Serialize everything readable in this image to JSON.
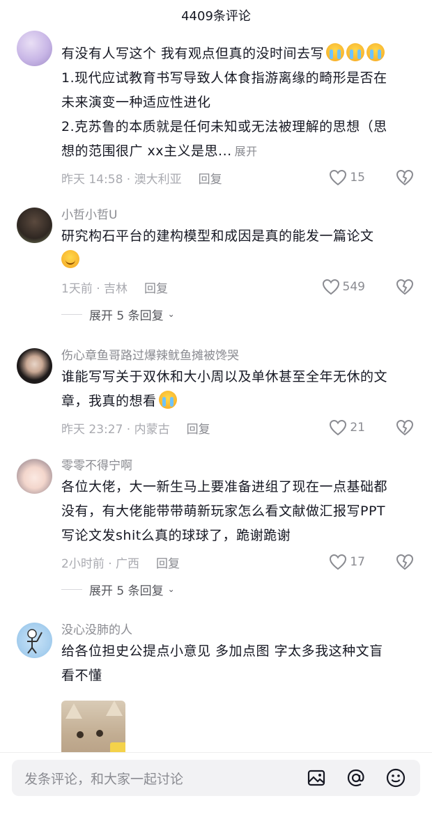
{
  "header": {
    "title": "4409条评论"
  },
  "comments": [
    {
      "username": "",
      "lines": [
        "有没有人写这个 我有观点但真的没时间去写",
        "1.现代应试教育书写导致人体食指游离缘的畸形是否在",
        "未来演变一种适应性进化",
        "2.克苏鲁的本质就是任何未知或无法被理解的思想（思",
        "想的范围很广 xx主义是思..."
      ],
      "expand_inline": "展开",
      "time": "昨天 14:58 · 澳大利亚",
      "reply": "回复",
      "likes": "15"
    },
    {
      "username": "小哲小哲U",
      "lines": [
        "研究构石平台的建构模型和成因是真的能发一篇论文"
      ],
      "time": "1天前 · 吉林",
      "reply": "回复",
      "likes": "549",
      "expand_replies": "展开 5 条回复"
    },
    {
      "username": "伤心章鱼哥路过爆辣鱿鱼摊被馋哭",
      "lines": [
        "谁能写写关于双休和大小周以及单休甚至全年无休的文",
        "章，我真的想看"
      ],
      "time": "昨天 23:27 · 内蒙古",
      "reply": "回复",
      "likes": "21"
    },
    {
      "username": "零零不得宁啊",
      "lines": [
        "各位大佬，大一新生马上要准备进组了现在一点基础都",
        "没有，有大佬能带带萌新玩家怎么看文献做汇报写PPT",
        "写论文发shit么真的球球了，跪谢跪谢"
      ],
      "time": "2小时前 · 广西",
      "reply": "回复",
      "likes": "17",
      "expand_replies": "展开 5 条回复"
    },
    {
      "username": "没心没肺的人",
      "lines": [
        "给各位担史公提点小意见  多加点图  字太多我这种文盲",
        "看不懂"
      ]
    }
  ],
  "input": {
    "placeholder": "发条评论，和大家一起讨论"
  },
  "icons": [
    "heart-icon",
    "dislike-heart-icon",
    "image-icon",
    "at-icon",
    "emoji-icon",
    "chevron-down-icon"
  ],
  "colors": {
    "text": "#161823",
    "secondary": "#8a8b91",
    "input_bg": "#f2f2f4"
  }
}
